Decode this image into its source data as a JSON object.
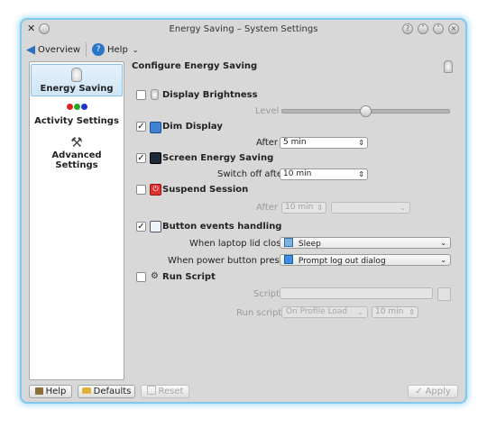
{
  "window": {
    "title": "Energy Saving – System Settings",
    "accent": "#7fc8ee"
  },
  "toolbar": {
    "overview_label": "Overview",
    "help_label": "Help"
  },
  "sidebar": {
    "items": [
      {
        "label": "Energy Saving",
        "icon": "lightbulb-icon",
        "selected": true
      },
      {
        "label": "Activity Settings",
        "icon": "activity-dots-icon",
        "selected": false
      },
      {
        "label": "Advanced Settings",
        "icon": "tools-icon",
        "selected": false
      }
    ]
  },
  "main": {
    "heading": "Configure Energy Saving",
    "display_brightness": {
      "label": "Display Brightness",
      "checked": false,
      "level_label": "Level",
      "level_value": 0.5
    },
    "dim_display": {
      "label": "Dim Display",
      "checked": true,
      "after_label": "After",
      "after_value": "5 min"
    },
    "screen_energy": {
      "label": "Screen Energy Saving",
      "checked": true,
      "switch_label": "Switch off after",
      "switch_value": "10 min"
    },
    "suspend": {
      "label": "Suspend Session",
      "checked": false,
      "after_label": "After",
      "after_value": "10 min",
      "action_value": ""
    },
    "button_events": {
      "label": "Button events handling",
      "checked": true,
      "lid_label": "When laptop lid closed",
      "lid_value": "Sleep",
      "power_label": "When power button pressed",
      "power_value": "Prompt log out dialog"
    },
    "run_script": {
      "label": "Run Script",
      "checked": false,
      "script_label": "Script",
      "script_value": "",
      "run_label": "Run script",
      "run_value": "On Profile Load",
      "run_time": "10 min"
    }
  },
  "footer": {
    "help_label": "Help",
    "defaults_label": "Defaults",
    "reset_label": "Reset",
    "apply_label": "Apply"
  }
}
